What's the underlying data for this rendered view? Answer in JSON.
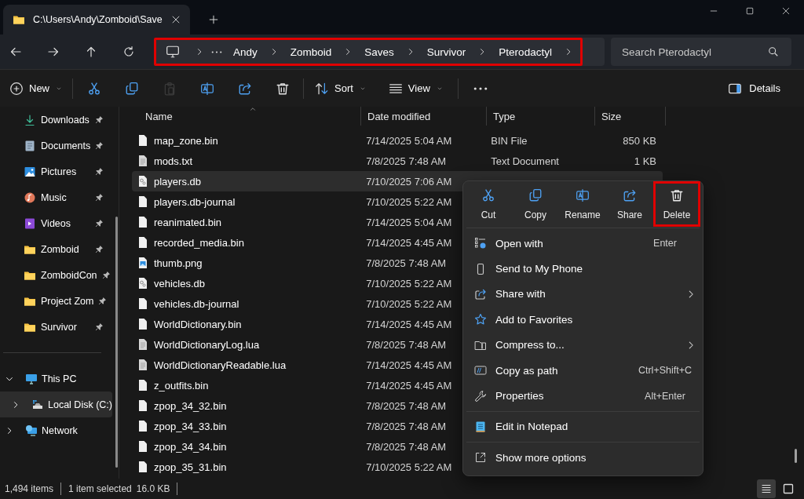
{
  "window": {
    "tab_title": "C:\\Users\\Andy\\Zomboid\\Save"
  },
  "address_bar": {
    "annotated": true,
    "crumbs": [
      "Andy",
      "Zomboid",
      "Saves",
      "Survivor",
      "Pterodactyl"
    ]
  },
  "search": {
    "placeholder": "Search Pterodactyl"
  },
  "command_bar": {
    "new_label": "New",
    "tools": [
      {
        "kind": "cut",
        "disabled": false
      },
      {
        "kind": "copy",
        "disabled": false
      },
      {
        "kind": "paste",
        "disabled": true
      },
      {
        "kind": "rename",
        "disabled": false
      },
      {
        "kind": "share",
        "disabled": false
      },
      {
        "kind": "delete",
        "disabled": false
      }
    ],
    "sort_label": "Sort",
    "view_label": "View",
    "details_label": "Details"
  },
  "sidebar": {
    "quick_access": [
      {
        "label": "Downloads",
        "kind": "downloads",
        "pinned": true
      },
      {
        "label": "Documents",
        "kind": "documents",
        "pinned": true
      },
      {
        "label": "Pictures",
        "kind": "pictures",
        "pinned": true
      },
      {
        "label": "Music",
        "kind": "music",
        "pinned": true
      },
      {
        "label": "Videos",
        "kind": "videos",
        "pinned": true
      },
      {
        "label": "Zomboid",
        "kind": "folder",
        "pinned": true
      },
      {
        "label": "ZomboidCon",
        "kind": "folder",
        "pinned": true
      },
      {
        "label": "Project Zom",
        "kind": "folder",
        "pinned": true
      },
      {
        "label": "Survivor",
        "kind": "folder",
        "pinned": true
      }
    ],
    "tree": [
      {
        "label": "This PC",
        "kind": "pc",
        "expanded": true,
        "selected": false,
        "children": [
          {
            "label": "Local Disk (C:)",
            "kind": "disk",
            "expanded": false,
            "selected": true
          }
        ]
      },
      {
        "label": "Network",
        "kind": "network",
        "expanded": false,
        "selected": false
      }
    ]
  },
  "file_list": {
    "columns": [
      {
        "label": "Name",
        "sorted": true
      },
      {
        "label": "Date modified",
        "sorted": false
      },
      {
        "label": "Type",
        "sorted": false
      },
      {
        "label": "Size",
        "sorted": false
      }
    ],
    "rows": [
      {
        "name": "map_zone.bin",
        "kind": "binary",
        "date": "7/14/2025 5:04 AM",
        "type": "BIN File",
        "size": "850 KB",
        "selected": false
      },
      {
        "name": "mods.txt",
        "kind": "text",
        "date": "7/8/2025 7:48 AM",
        "type": "Text Document",
        "size": "1 KB",
        "selected": false
      },
      {
        "name": "players.db",
        "kind": "database",
        "date": "7/10/2025 7:06 AM",
        "selected": true
      },
      {
        "name": "players.db-journal",
        "kind": "binary",
        "date": "7/10/2025 5:22 AM",
        "selected": false
      },
      {
        "name": "reanimated.bin",
        "kind": "binary",
        "date": "7/14/2025 5:04 AM",
        "selected": false
      },
      {
        "name": "recorded_media.bin",
        "kind": "binary",
        "date": "7/14/2025 4:45 AM",
        "selected": false
      },
      {
        "name": "thumb.png",
        "kind": "image",
        "date": "7/8/2025 7:48 AM",
        "selected": false
      },
      {
        "name": "vehicles.db",
        "kind": "database",
        "date": "7/10/2025 5:22 AM",
        "selected": false
      },
      {
        "name": "vehicles.db-journal",
        "kind": "binary",
        "date": "7/10/2025 5:22 AM",
        "selected": false
      },
      {
        "name": "WorldDictionary.bin",
        "kind": "binary",
        "date": "7/14/2025 4:45 AM",
        "selected": false
      },
      {
        "name": "WorldDictionaryLog.lua",
        "kind": "text",
        "date": "7/8/2025 7:48 AM",
        "selected": false
      },
      {
        "name": "WorldDictionaryReadable.lua",
        "kind": "text",
        "date": "7/14/2025 4:45 AM",
        "selected": false
      },
      {
        "name": "z_outfits.bin",
        "kind": "binary",
        "date": "7/14/2025 4:45 AM",
        "selected": false
      },
      {
        "name": "zpop_34_32.bin",
        "kind": "binary",
        "date": "7/8/2025 7:48 AM",
        "selected": false
      },
      {
        "name": "zpop_34_33.bin",
        "kind": "binary",
        "date": "7/8/2025 7:48 AM",
        "selected": false
      },
      {
        "name": "zpop_34_34.bin",
        "kind": "binary",
        "date": "7/8/2025 7:48 AM",
        "selected": false
      },
      {
        "name": "zpop_35_31.bin",
        "kind": "binary",
        "date": "7/10/2025 5:22 AM",
        "selected": false
      }
    ]
  },
  "status_bar": {
    "count": "1,494 items",
    "selection": "1 item selected",
    "size": "16.0 KB",
    "view_modes": [
      {
        "kind": "details",
        "selected": true
      },
      {
        "kind": "tiles",
        "selected": false
      }
    ]
  },
  "context_menu": {
    "actions": [
      {
        "label": "Cut",
        "kind": "cut",
        "annotated": false
      },
      {
        "label": "Copy",
        "kind": "copy",
        "annotated": false
      },
      {
        "label": "Rename",
        "kind": "rename",
        "annotated": false
      },
      {
        "label": "Share",
        "kind": "share",
        "annotated": false
      },
      {
        "label": "Delete",
        "kind": "delete",
        "annotated": true
      }
    ],
    "groups": [
      [
        {
          "label": "Open with",
          "kind": "open_with",
          "shortcut": "Enter",
          "submenu": false
        },
        {
          "label": "Send to My Phone",
          "kind": "phone",
          "submenu": false
        },
        {
          "label": "Share with",
          "kind": "share",
          "submenu": true
        },
        {
          "label": "Add to Favorites",
          "kind": "favorite",
          "submenu": false
        },
        {
          "label": "Compress to...",
          "kind": "compress",
          "submenu": true
        },
        {
          "label": "Copy as path",
          "kind": "copy_path",
          "shortcut": "Ctrl+Shift+C",
          "submenu": false
        },
        {
          "label": "Properties",
          "kind": "properties",
          "shortcut": "Alt+Enter",
          "submenu": false
        }
      ],
      [
        {
          "label": "Edit in Notepad",
          "kind": "notepad",
          "submenu": false
        }
      ],
      [
        {
          "label": "Show more options",
          "kind": "more",
          "submenu": false
        }
      ]
    ]
  }
}
